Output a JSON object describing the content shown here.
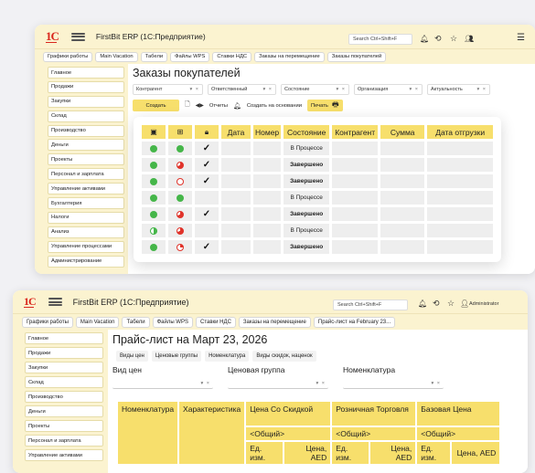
{
  "window1": {
    "logo": "1С",
    "app_title": "FirstBit ERP (1С:Предприятие)",
    "search_placeholder": "Search Ctrl+Shift+F",
    "tabs": [
      "Графики работы",
      "Main Vacation",
      "Табели",
      "Файлы WPS",
      "Ставки НДС",
      "Заказы на перемещение",
      "Заказы покупателей"
    ],
    "sidebar": [
      "Главное",
      "Продажи",
      "Закупки",
      "Склад",
      "Производство",
      "Деньги",
      "Проекты",
      "Персонал и зарплата",
      "Управление активами",
      "Бухгалтерия",
      "Налоги",
      "Анализ",
      "Управление процессами",
      "Администрирование"
    ],
    "page_title": "Заказы покупателей",
    "filters": [
      "Контрагент",
      "Ответственный",
      "Состояние",
      "Организация",
      "Актуальность"
    ],
    "filter_ctl": "▾ ×",
    "toolbar": {
      "create": "Создать",
      "arrows": "◀▶",
      "reports": "Отчеты",
      "create_based": "Создать на основании",
      "print": "Печать"
    },
    "grid": {
      "headers": [
        "Дата",
        "Номер",
        "Состояние",
        "Контрагент",
        "Сумма",
        "Дата отгрузки"
      ],
      "rows": [
        {
          "s1": "g",
          "s2": "g",
          "check": "✓",
          "state": "В Процессе",
          "bold": false
        },
        {
          "s1": "g",
          "s2": "rh",
          "check": "✓",
          "state": "Завершено",
          "bold": true
        },
        {
          "s1": "g",
          "s2": "ro",
          "check": "✓",
          "state": "Завершено",
          "bold": true
        },
        {
          "s1": "g",
          "s2": "g",
          "check": "",
          "state": "В Процессе",
          "bold": false
        },
        {
          "s1": "g",
          "s2": "rh",
          "check": "✓",
          "state": "Завершено",
          "bold": true
        },
        {
          "s1": "gh",
          "s2": "rh",
          "check": "",
          "state": "В Процессе",
          "bold": false
        },
        {
          "s1": "g",
          "s2": "rq",
          "check": "✓",
          "state": "Завершено",
          "bold": true
        }
      ]
    }
  },
  "window2": {
    "logo": "1С",
    "app_title": "FirstBit ERP (1С:Предприятие)",
    "search_placeholder": "Search Ctrl+Shift+F",
    "user": "Administrator",
    "tabs": [
      "Графики работы",
      "Main Vacation",
      "Табели",
      "Файлы WPS",
      "Ставки НДС",
      "Заказы на перемещение",
      "Прайс-лист на February 23..."
    ],
    "sidebar": [
      "Главное",
      "Продажи",
      "Закупки",
      "Склад",
      "Производство",
      "Деньги",
      "Проекты",
      "Персонал и зарплата",
      "Управление активами"
    ],
    "page_title": "Прайс-лист на Март 23, 2026",
    "subtabs": [
      "Виды цен",
      "Ценовые группы",
      "Номенклатура",
      "Виды скидок, наценок"
    ],
    "filters": [
      {
        "label": "Вид цен",
        "ctl": "▾ ×"
      },
      {
        "label": "Ценовая группа",
        "ctl": "▾ ×"
      },
      {
        "label": "Номенклатура",
        "ctl": "▾ ×"
      }
    ],
    "price": {
      "col_nom": "Номенклатура",
      "col_char": "Характеристика",
      "groups": [
        "Цена Со Скидкой",
        "Розничная Торговля",
        "Базовая Цена"
      ],
      "general": "<Общий>",
      "unit": "Ед. изм.",
      "price_col": "Цена, AED"
    }
  }
}
